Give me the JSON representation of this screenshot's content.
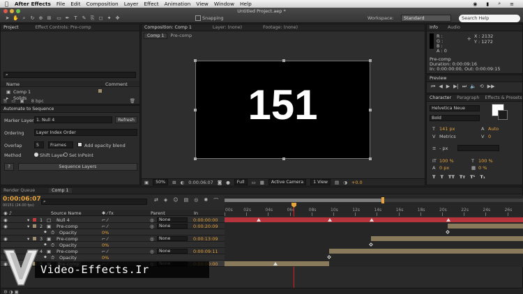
{
  "menu": {
    "apple": "",
    "app": "After Effects",
    "items": [
      "File",
      "Edit",
      "Composition",
      "Layer",
      "Effect",
      "Animation",
      "View",
      "Window",
      "Help"
    ]
  },
  "window_title": "Untitled Project.aep *",
  "toolbar": {
    "snapping": "Snapping",
    "workspace_label": "Workspace:",
    "workspace_value": "Standard",
    "search_placeholder": "Search Help"
  },
  "project": {
    "tabs": [
      "Project",
      "Effect Controls: Pre-comp"
    ],
    "search_placeholder": "",
    "col_name": "Name",
    "col_comment": "Comment",
    "items": [
      "Comp 1",
      "Solids"
    ],
    "bpc": "8 bpc"
  },
  "sequence": {
    "tab": "Automate to Sequence",
    "marker_layer_label": "Marker Layer",
    "marker_layer_value": "1. Null 4",
    "refresh": "Refresh",
    "ordering_label": "Ordering",
    "ordering_value": "Layer Index Order",
    "overlap_label": "Overlap",
    "overlap_value": "5",
    "overlap_unit": "Frames",
    "opacity_blend": "Add opacity blend",
    "method_label": "Method",
    "method_shift": "Shift Layer",
    "method_inpoint": "Set InPoint",
    "help": "?",
    "seq_button": "Sequence Layers"
  },
  "comp": {
    "tabs": [
      "Composition: Comp 1",
      "Layer: (none)",
      "Footage: (none)"
    ],
    "breadcrumbs": [
      "Comp 1",
      "Pre-comp"
    ],
    "number": "151",
    "zoom": "50%",
    "timecode": "0:00:06:07",
    "resolution": "Full",
    "camera": "Active Camera",
    "view": "1 View",
    "exposure": "+0.0"
  },
  "info": {
    "tabs": [
      "Info",
      "Audio"
    ],
    "r": "R :",
    "g": "G :",
    "b": "B :",
    "a": "A : 0",
    "x": "X : 2132",
    "y": "Y : 1272",
    "name": "Pre-comp",
    "duration": "Duration: 0:00:09:16",
    "inout": "In: 0:00:00:00, Out: 0:00:09:15"
  },
  "preview": {
    "tab": "Preview"
  },
  "effects": {
    "tab": "Effects & Presets"
  },
  "character": {
    "tabs": [
      "Character",
      "Paragraph"
    ],
    "font": "Helvetica Neue",
    "style": "Bold",
    "size": "141 px",
    "leading": "Auto",
    "kern": "Metrics",
    "track": "0",
    "indent": "- px",
    "vscale": "100 %",
    "hscale": "100 %",
    "baseline": "0 px",
    "tsume": "0 %"
  },
  "timeline": {
    "tabs": [
      "Render Queue",
      "Comp 1"
    ],
    "timecode": "0:00:06:07",
    "fps": "00151 (24.00 fps)",
    "col_source": "Source Name",
    "col_parent": "Parent",
    "col_in": "In",
    "ruler": [
      "00s",
      "02s",
      "04s",
      "06s",
      "08s",
      "10s",
      "12s",
      "14s",
      "16s",
      "18s",
      "20s",
      "22s",
      "24s",
      "26s"
    ],
    "rows": [
      {
        "num": "1",
        "name": "Null 4",
        "parent": "None",
        "in": "0:00:00:00",
        "color": "#c53a3a"
      },
      {
        "num": "2",
        "name": "Pre-comp",
        "parent": "None",
        "in": "0:00:20:09",
        "color": "#a08f6d"
      },
      {
        "num": "",
        "name": "Opacity",
        "parent": "",
        "in": "",
        "color": ""
      },
      {
        "num": "3",
        "name": "Pre-comp",
        "parent": "None",
        "in": "0:00:13:09",
        "color": "#a08f6d"
      },
      {
        "num": "",
        "name": "Opacity",
        "parent": "",
        "in": "",
        "color": ""
      },
      {
        "num": "4",
        "name": "Pre-comp",
        "parent": "None",
        "in": "0:00:09:11",
        "color": "#a08f6d"
      },
      {
        "num": "",
        "name": "Opacity",
        "parent": "",
        "in": "",
        "color": ""
      },
      {
        "num": "5",
        "name": "Pre-comp",
        "parent": "None",
        "in": "0:00:00:00",
        "color": "#a08f6d"
      }
    ],
    "opacity_val": "0%"
  },
  "watermark": "Video-Effects.Ir",
  "colors": {
    "accent": "#e8a33a",
    "timeline_red": "#c53a3a",
    "bar_tan": "#8a7a5c"
  }
}
